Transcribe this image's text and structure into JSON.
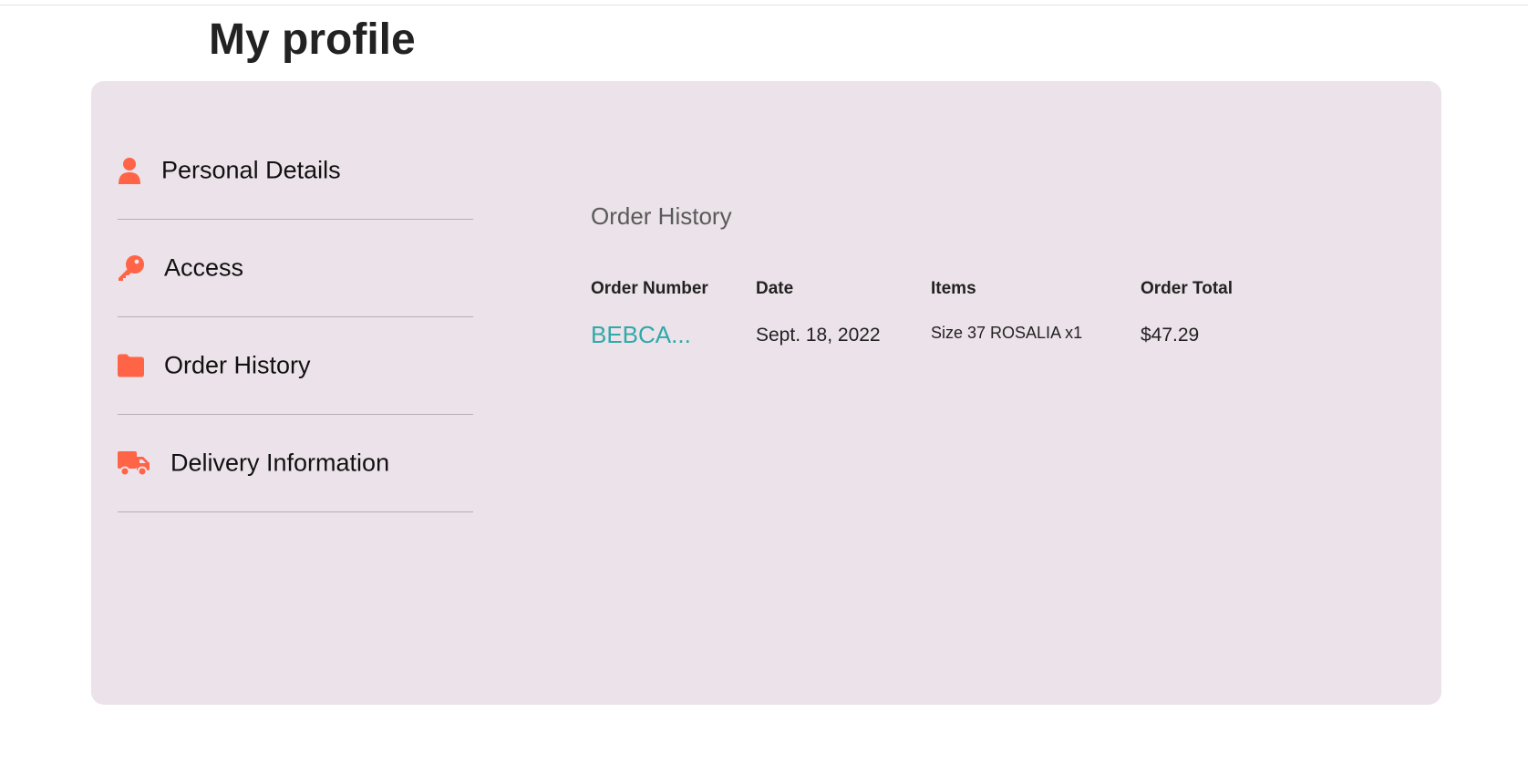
{
  "page": {
    "title": "My profile"
  },
  "colors": {
    "accent": "#ff6447",
    "panel_bg": "#ece2e9",
    "link": "#2fa9a9"
  },
  "sidebar": {
    "items": [
      {
        "label": "Personal Details",
        "icon": "person-icon"
      },
      {
        "label": "Access",
        "icon": "key-icon"
      },
      {
        "label": "Order History",
        "icon": "folder-icon"
      },
      {
        "label": "Delivery Information",
        "icon": "truck-icon"
      }
    ]
  },
  "orders": {
    "title": "Order History",
    "columns": [
      "Order Number",
      "Date",
      "Items",
      "Order Total"
    ],
    "rows": [
      {
        "order_number": "BEBCA...",
        "date": "Sept. 18, 2022",
        "items": "Size 37 ROSALIA x1",
        "total": "$47.29"
      }
    ]
  }
}
